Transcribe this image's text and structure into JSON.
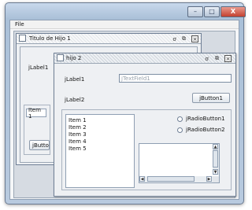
{
  "window": {
    "buttons": {
      "minimize": "–",
      "maximize": "□",
      "close": "X"
    }
  },
  "menu": {
    "file_label": "File"
  },
  "frame1": {
    "title": "Titulo de Hijo 1",
    "label1": "jLabel1",
    "field_value": "Item 1",
    "button_label": "jButto"
  },
  "frame2": {
    "title": "hijo 2",
    "label1": "jLabel1",
    "label2": "jLabel2",
    "textfield_value": "jTextField1",
    "button1_label": "jButton1",
    "list_items": [
      "Item 1",
      "Item 2",
      "Item 3",
      "Item 4",
      "Item 5"
    ],
    "radio1_label": "jRadioButton1",
    "radio2_label": "jRadioButton2"
  },
  "frame_buttons": {
    "iconify": "ơ",
    "maximize": "⧉",
    "close": "×"
  }
}
